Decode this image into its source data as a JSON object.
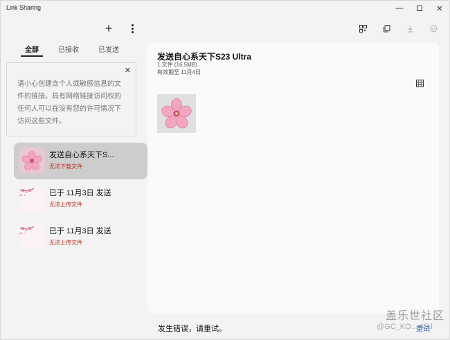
{
  "window": {
    "title": "Link Sharing",
    "minimize_glyph": "—",
    "close_glyph": "✕"
  },
  "left_toolbar": {
    "add_glyph": "+",
    "add_icon": "plus-icon",
    "more_icon": "more-vertical-icon"
  },
  "tabs": [
    {
      "label": "全部",
      "active": true
    },
    {
      "label": "已接收",
      "active": false
    },
    {
      "label": "已发送",
      "active": false
    }
  ],
  "warning": {
    "text": "请小心创建含个人或敏感信息的文件的链接。具有网络链接访问权的任何人可以在没有您的许可情况下访问这些文件。",
    "close_glyph": "✕"
  },
  "list": [
    {
      "name": "发送自心系天下S...",
      "status": "无法下载文件",
      "selected": true,
      "thumb": "cherry-blossom"
    },
    {
      "name": "已于 11月3日 发送",
      "status": "无法上传文件",
      "selected": false,
      "thumb": "blossom-branch"
    },
    {
      "name": "已于 11月3日 发送",
      "status": "无法上传文件",
      "selected": false,
      "thumb": "blossom-branch"
    }
  ],
  "right_toolbar": {
    "icons": [
      "qr-code-icon",
      "copy-icon",
      "download-icon",
      "check-circle-icon"
    ]
  },
  "detail": {
    "title": "发送自心系天下S23 Ultra",
    "size": "1 文件 (16.5MB)",
    "expire": "有效期至 11月4日",
    "grid_icon": "grid-view-icon"
  },
  "footer": {
    "error": "发生错误，请重试。",
    "retry_label": "重试"
  },
  "watermark": {
    "line1": "盖乐世社区",
    "line2": "@GC_KO... 4SJ"
  },
  "colors": {
    "error": "#c42b1c",
    "selected_bg": "#cdcdcd",
    "accent": "#2f66c8",
    "blossom": "#f2a6bf"
  }
}
